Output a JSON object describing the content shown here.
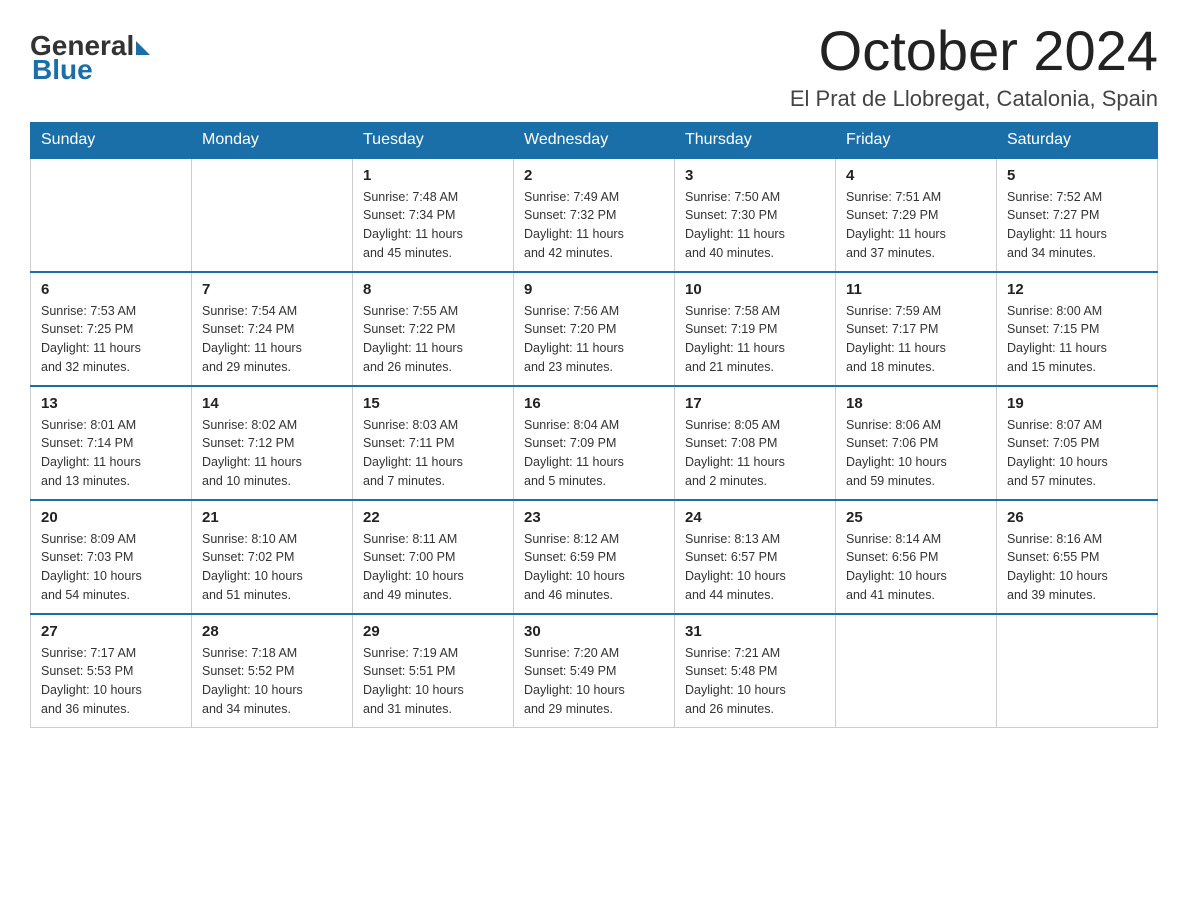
{
  "logo": {
    "general": "General",
    "blue": "Blue"
  },
  "header": {
    "title": "October 2024",
    "location": "El Prat de Llobregat, Catalonia, Spain"
  },
  "weekdays": [
    "Sunday",
    "Monday",
    "Tuesday",
    "Wednesday",
    "Thursday",
    "Friday",
    "Saturday"
  ],
  "weeks": [
    [
      {
        "day": "",
        "info": ""
      },
      {
        "day": "",
        "info": ""
      },
      {
        "day": "1",
        "info": "Sunrise: 7:48 AM\nSunset: 7:34 PM\nDaylight: 11 hours\nand 45 minutes."
      },
      {
        "day": "2",
        "info": "Sunrise: 7:49 AM\nSunset: 7:32 PM\nDaylight: 11 hours\nand 42 minutes."
      },
      {
        "day": "3",
        "info": "Sunrise: 7:50 AM\nSunset: 7:30 PM\nDaylight: 11 hours\nand 40 minutes."
      },
      {
        "day": "4",
        "info": "Sunrise: 7:51 AM\nSunset: 7:29 PM\nDaylight: 11 hours\nand 37 minutes."
      },
      {
        "day": "5",
        "info": "Sunrise: 7:52 AM\nSunset: 7:27 PM\nDaylight: 11 hours\nand 34 minutes."
      }
    ],
    [
      {
        "day": "6",
        "info": "Sunrise: 7:53 AM\nSunset: 7:25 PM\nDaylight: 11 hours\nand 32 minutes."
      },
      {
        "day": "7",
        "info": "Sunrise: 7:54 AM\nSunset: 7:24 PM\nDaylight: 11 hours\nand 29 minutes."
      },
      {
        "day": "8",
        "info": "Sunrise: 7:55 AM\nSunset: 7:22 PM\nDaylight: 11 hours\nand 26 minutes."
      },
      {
        "day": "9",
        "info": "Sunrise: 7:56 AM\nSunset: 7:20 PM\nDaylight: 11 hours\nand 23 minutes."
      },
      {
        "day": "10",
        "info": "Sunrise: 7:58 AM\nSunset: 7:19 PM\nDaylight: 11 hours\nand 21 minutes."
      },
      {
        "day": "11",
        "info": "Sunrise: 7:59 AM\nSunset: 7:17 PM\nDaylight: 11 hours\nand 18 minutes."
      },
      {
        "day": "12",
        "info": "Sunrise: 8:00 AM\nSunset: 7:15 PM\nDaylight: 11 hours\nand 15 minutes."
      }
    ],
    [
      {
        "day": "13",
        "info": "Sunrise: 8:01 AM\nSunset: 7:14 PM\nDaylight: 11 hours\nand 13 minutes."
      },
      {
        "day": "14",
        "info": "Sunrise: 8:02 AM\nSunset: 7:12 PM\nDaylight: 11 hours\nand 10 minutes."
      },
      {
        "day": "15",
        "info": "Sunrise: 8:03 AM\nSunset: 7:11 PM\nDaylight: 11 hours\nand 7 minutes."
      },
      {
        "day": "16",
        "info": "Sunrise: 8:04 AM\nSunset: 7:09 PM\nDaylight: 11 hours\nand 5 minutes."
      },
      {
        "day": "17",
        "info": "Sunrise: 8:05 AM\nSunset: 7:08 PM\nDaylight: 11 hours\nand 2 minutes."
      },
      {
        "day": "18",
        "info": "Sunrise: 8:06 AM\nSunset: 7:06 PM\nDaylight: 10 hours\nand 59 minutes."
      },
      {
        "day": "19",
        "info": "Sunrise: 8:07 AM\nSunset: 7:05 PM\nDaylight: 10 hours\nand 57 minutes."
      }
    ],
    [
      {
        "day": "20",
        "info": "Sunrise: 8:09 AM\nSunset: 7:03 PM\nDaylight: 10 hours\nand 54 minutes."
      },
      {
        "day": "21",
        "info": "Sunrise: 8:10 AM\nSunset: 7:02 PM\nDaylight: 10 hours\nand 51 minutes."
      },
      {
        "day": "22",
        "info": "Sunrise: 8:11 AM\nSunset: 7:00 PM\nDaylight: 10 hours\nand 49 minutes."
      },
      {
        "day": "23",
        "info": "Sunrise: 8:12 AM\nSunset: 6:59 PM\nDaylight: 10 hours\nand 46 minutes."
      },
      {
        "day": "24",
        "info": "Sunrise: 8:13 AM\nSunset: 6:57 PM\nDaylight: 10 hours\nand 44 minutes."
      },
      {
        "day": "25",
        "info": "Sunrise: 8:14 AM\nSunset: 6:56 PM\nDaylight: 10 hours\nand 41 minutes."
      },
      {
        "day": "26",
        "info": "Sunrise: 8:16 AM\nSunset: 6:55 PM\nDaylight: 10 hours\nand 39 minutes."
      }
    ],
    [
      {
        "day": "27",
        "info": "Sunrise: 7:17 AM\nSunset: 5:53 PM\nDaylight: 10 hours\nand 36 minutes."
      },
      {
        "day": "28",
        "info": "Sunrise: 7:18 AM\nSunset: 5:52 PM\nDaylight: 10 hours\nand 34 minutes."
      },
      {
        "day": "29",
        "info": "Sunrise: 7:19 AM\nSunset: 5:51 PM\nDaylight: 10 hours\nand 31 minutes."
      },
      {
        "day": "30",
        "info": "Sunrise: 7:20 AM\nSunset: 5:49 PM\nDaylight: 10 hours\nand 29 minutes."
      },
      {
        "day": "31",
        "info": "Sunrise: 7:21 AM\nSunset: 5:48 PM\nDaylight: 10 hours\nand 26 minutes."
      },
      {
        "day": "",
        "info": ""
      },
      {
        "day": "",
        "info": ""
      }
    ]
  ]
}
